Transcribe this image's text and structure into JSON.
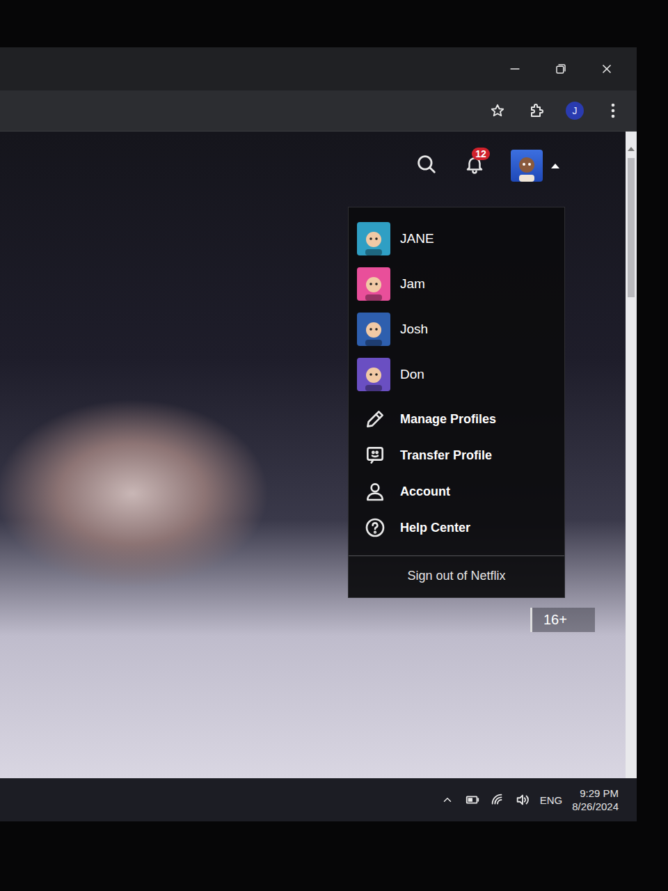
{
  "browser": {
    "profile_initial": "J"
  },
  "netflix": {
    "notifications_badge": "12",
    "profiles": [
      {
        "name": "JANE",
        "selected": false,
        "color": "#2f9fc4"
      },
      {
        "name": "Jam",
        "selected": false,
        "color": "#e94f9a"
      },
      {
        "name": "Josh",
        "selected": false,
        "color": "#2e5fae"
      },
      {
        "name": "Don",
        "selected": false,
        "color": "#6a4fc2"
      }
    ],
    "menu_items": [
      "Manage Profiles",
      "Transfer Profile",
      "Account",
      "Help Center"
    ],
    "sign_out": "Sign out of Netflix",
    "maturity_rating": "16+"
  },
  "taskbar": {
    "language": "ENG",
    "time": "9:29 PM",
    "date": "8/26/2024"
  }
}
